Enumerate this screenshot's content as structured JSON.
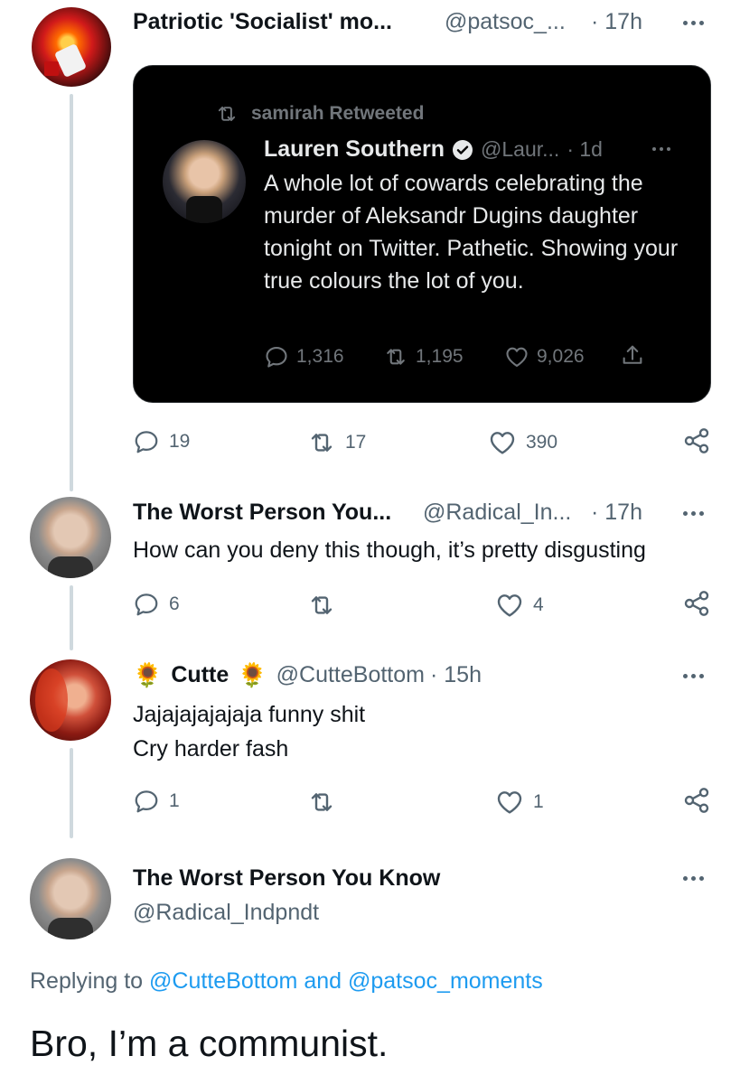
{
  "tweet1": {
    "name": "Patriotic 'Socialist' mo...",
    "handle": "@patsoc_...",
    "time": "· 17h",
    "quoted": {
      "retweet_label": "samirah Retweeted",
      "name": "Lauren Southern",
      "handle": "@Laur...",
      "time": "· 1d",
      "text": "A whole lot of cowards celebrating the murder of Aleksandr Dugins daughter tonight on Twitter. Pathetic. Showing your true colours the lot of you.",
      "replies": "1,316",
      "retweets": "1,195",
      "likes": "9,026"
    },
    "replies": "19",
    "retweets": "17",
    "likes": "390"
  },
  "tweet2": {
    "name": "The Worst Person You...",
    "handle": "@Radical_In...",
    "time": "· 17h",
    "text": "How can you deny this though, it’s pretty disgusting",
    "replies": "6",
    "retweets": "",
    "likes": "4"
  },
  "tweet3": {
    "emoji": "🌻",
    "name": "Cutte",
    "handle": "@CutteBottom",
    "time": "· 15h",
    "line1": "Jajajajajajaja funny shit",
    "line2": "Cry harder fash",
    "replies": "1",
    "retweets": "",
    "likes": "1"
  },
  "tweet4": {
    "name": "The Worst Person You Know",
    "handle": "@Radical_Indpndt",
    "replying_prefix": "Replying to",
    "mention1": "@CutteBottom",
    "and": "and",
    "mention2": "@patsoc_moments",
    "text": "Bro, I’m a communist."
  },
  "colors": {
    "accent": "#1d9bf0",
    "secondary_text": "#536471",
    "thread_line": "#cfd9de",
    "card_bg": "#000000"
  },
  "icons": [
    "reply-icon",
    "retweet-icon",
    "like-icon",
    "share-icon",
    "more-icon",
    "verified-icon"
  ]
}
